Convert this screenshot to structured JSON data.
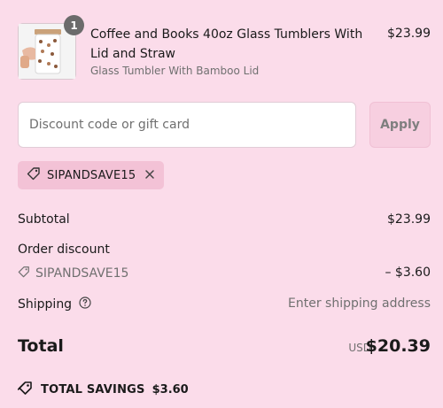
{
  "product": {
    "quantity": "1",
    "title": "Coffee and Books 40oz Glass Tumblers With Lid and Straw",
    "variant": "Glass Tumbler With Bamboo Lid",
    "price": "$23.99"
  },
  "discount": {
    "placeholder": "Discount code or gift card",
    "apply_label": "Apply",
    "applied_code": "SIPANDSAVE15"
  },
  "summary": {
    "subtotal_label": "Subtotal",
    "subtotal_value": "$23.99",
    "order_discount_label": "Order discount",
    "order_discount_code": "SIPANDSAVE15",
    "order_discount_value": "– $3.60",
    "shipping_label": "Shipping",
    "shipping_value": "Enter shipping address",
    "total_label": "Total",
    "total_currency": "USD",
    "total_value": "$20.39",
    "savings_label": "TOTAL SAVINGS",
    "savings_value": "$3.60"
  },
  "colors": {
    "background": "#fbdcea",
    "chip": "#f3c2d6",
    "apply_button": "#f7cfe0"
  },
  "icons": [
    "tumbler-product-image",
    "tag-icon",
    "close-icon",
    "help-circle-icon",
    "savings-tag-icon"
  ]
}
